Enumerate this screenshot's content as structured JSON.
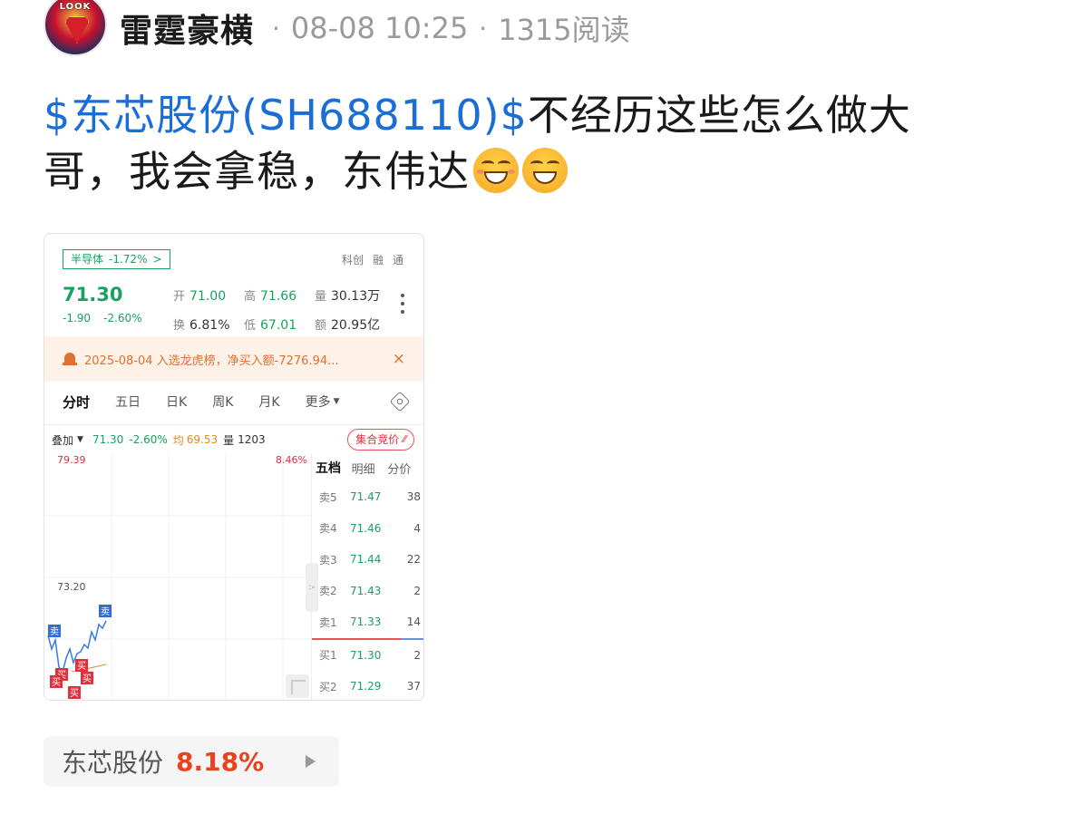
{
  "author": {
    "avatar_text": "LOOK",
    "name": "雷霆豪横"
  },
  "meta": {
    "separator": "·",
    "time": "08-08 10:25",
    "reads": "1315阅读"
  },
  "post": {
    "stock_link": "$东芯股份(SH688110)$",
    "text_part1": "不经历这些怎么做大哥，我会拿稳，东伟达"
  },
  "emojis": [
    "grin-face-emoji",
    "big-grin-emoji"
  ],
  "card": {
    "sector_tag": {
      "label": "半导体",
      "pct": "-1.72%",
      "arrow": ">"
    },
    "badges": [
      "科创",
      "融",
      "通"
    ],
    "price": "71.30",
    "change": "-1.90",
    "change_pct": "-2.60%",
    "quote": [
      {
        "label": "开",
        "value": "71.00",
        "color": "green"
      },
      {
        "label": "高",
        "value": "71.66",
        "color": "green"
      },
      {
        "label": "量",
        "value": "30.13万",
        "color": "dark"
      },
      {
        "label": "换",
        "value": "6.81%",
        "color": "dark"
      },
      {
        "label": "低",
        "value": "67.01",
        "color": "green"
      },
      {
        "label": "额",
        "value": "20.95亿",
        "color": "dark"
      }
    ],
    "notice": {
      "text": "2025-08-04 入选龙虎榜，净买入额-7276.94...",
      "close": "×"
    },
    "tabs": [
      "分时",
      "五日",
      "日K",
      "周K",
      "月K"
    ],
    "tab_more": "更多",
    "overlay": {
      "label": "叠加",
      "price": "71.30",
      "pct": "-2.60%",
      "avg_label": "均",
      "avg": "69.53",
      "vol_label": "量",
      "vol": "1203"
    },
    "auction_button": "集合竞价",
    "chart": {
      "top_price": "79.39",
      "top_pct": "8.46%",
      "mid_price": "73.20",
      "markers": [
        "卖",
        "卖",
        "买",
        "买",
        "买",
        "买",
        "买"
      ]
    },
    "book_tabs": [
      "五档",
      "明细",
      "分价"
    ],
    "book": {
      "asks": [
        {
          "side": "卖5",
          "price": "71.47",
          "vol": "38"
        },
        {
          "side": "卖4",
          "price": "71.46",
          "vol": "4"
        },
        {
          "side": "卖3",
          "price": "71.44",
          "vol": "22"
        },
        {
          "side": "卖2",
          "price": "71.43",
          "vol": "2"
        },
        {
          "side": "卖1",
          "price": "71.33",
          "vol": "14"
        }
      ],
      "bids": [
        {
          "side": "买1",
          "price": "71.30",
          "vol": "2"
        },
        {
          "side": "买2",
          "price": "71.29",
          "vol": "37"
        }
      ]
    }
  },
  "stock_chip": {
    "name": "东芯股份",
    "pct": "8.18%"
  },
  "colors": {
    "green": "#19a15f",
    "red": "#e0303c",
    "link": "#1b6ed6",
    "orange": "#e8421e"
  }
}
